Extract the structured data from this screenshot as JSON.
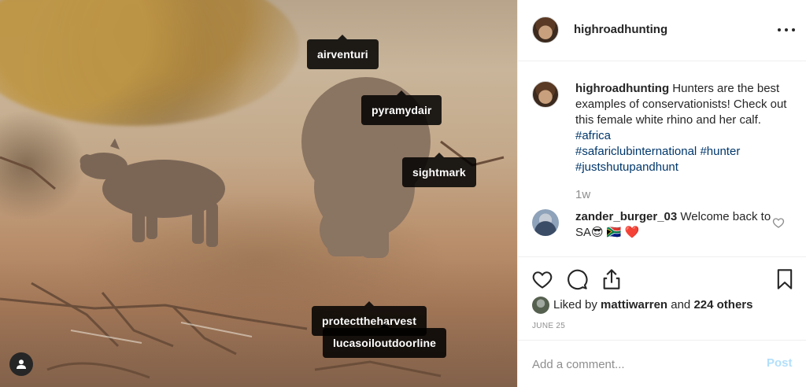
{
  "photo": {
    "tags": [
      {
        "id": "airventuri",
        "label": "airventuri"
      },
      {
        "id": "pyramydair",
        "label": "pyramydair"
      },
      {
        "id": "sightmark",
        "label": "sightmark"
      },
      {
        "id": "protecttheharvest",
        "label": "protecttheharvest"
      },
      {
        "id": "lucasoiloutdoorline",
        "label": "lucasoiloutdoorline"
      }
    ],
    "user_badge_icon": "user-icon"
  },
  "header": {
    "username": "highroadhunting",
    "more_icon": "more-options-icon"
  },
  "caption": {
    "username": "highroadhunting",
    "text": " Hunters are the best examples of conservationists! Check out this female white rhino and her calf. ",
    "hashtags": [
      "#africa",
      "#safariclubinternational",
      "#hunter",
      "#justshutupandhunt"
    ],
    "time": "1w"
  },
  "comment": {
    "username": "zander_burger_03",
    "text": " Welcome back to SA😎 🇿🇦 ❤️",
    "like_icon": "heart-outline-icon"
  },
  "actions": {
    "like_icon": "heart-outline-icon",
    "comment_icon": "comment-bubble-icon",
    "share_icon": "share-icon",
    "save_icon": "bookmark-icon",
    "liked_prefix": "Liked by ",
    "liked_user": "mattiwarren",
    "liked_middle": " and ",
    "liked_count": "224 others",
    "date": "JUNE 25"
  },
  "add_comment": {
    "placeholder": "Add a comment...",
    "post_label": "Post"
  },
  "colors": {
    "text": "#262626",
    "secondary": "#8e8e8e",
    "hashtag": "#00376b",
    "post_disabled": "#b2dffc",
    "divider": "#efefef"
  }
}
